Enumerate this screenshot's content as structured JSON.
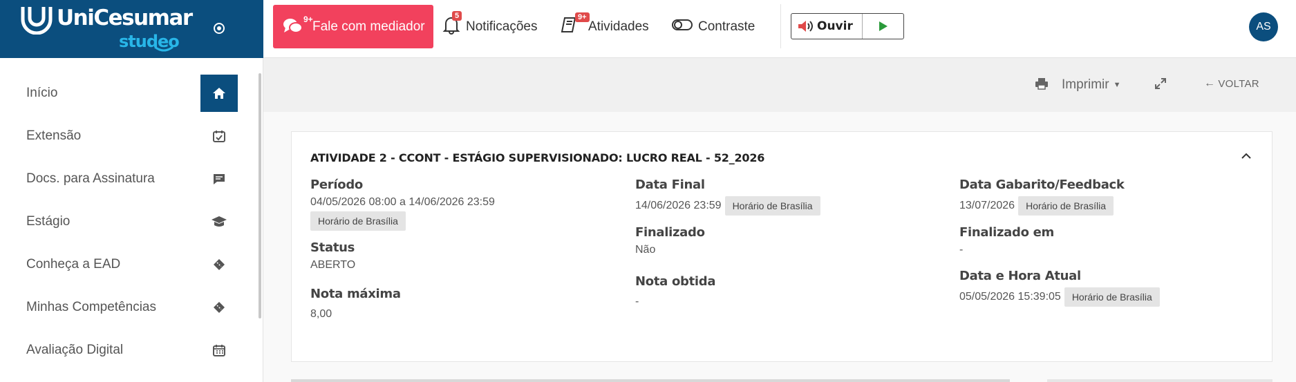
{
  "brand": {
    "name": "UniCesumar",
    "sub": "studeo",
    "primary": "#0b4e7e",
    "accent": "#28b6e8"
  },
  "header": {
    "mediador": {
      "label": "Fale com mediador",
      "badge": "9+",
      "color": "#f2415d"
    },
    "notificacoes": {
      "label": "Notificações",
      "badge": "5"
    },
    "atividades": {
      "label": "Atividades",
      "badge": "9+"
    },
    "contraste": {
      "label": "Contraste"
    },
    "ouvir": {
      "label": "Ouvir"
    },
    "avatar": "AS"
  },
  "sidebar": {
    "items": [
      {
        "label": "Início",
        "icon": "home-icon",
        "active": true
      },
      {
        "label": "Extensão",
        "icon": "calendar-check-icon"
      },
      {
        "label": "Docs. para Assinatura",
        "icon": "chat-icon"
      },
      {
        "label": "Estágio",
        "icon": "graduation-cap-icon"
      },
      {
        "label": "Conheça a EAD",
        "icon": "ticket-icon"
      },
      {
        "label": "Minhas Competências",
        "icon": "ticket-icon"
      },
      {
        "label": "Avaliação Digital",
        "icon": "calendar-icon"
      }
    ]
  },
  "toolbar": {
    "print_label": "Imprimir",
    "back_label": "VOLTAR"
  },
  "activity": {
    "title": "ATIVIDADE 2 - CCONT - ESTÁGIO SUPERVISIONADO: LUCRO REAL - 52_2026",
    "periodo_label": "Período",
    "periodo_value": "04/05/2026 08:00 a 14/06/2026 23:59",
    "tz": "Horário de Brasília",
    "status_label": "Status",
    "status_value": "ABERTO",
    "nota_max_label": "Nota máxima",
    "nota_max_value": "8,00",
    "data_final_label": "Data Final",
    "data_final_value": "14/06/2026 23:59",
    "finalizado_label": "Finalizado",
    "finalizado_value": "Não",
    "nota_obtida_label": "Nota obtida",
    "nota_obtida_value": "-",
    "gabarito_label": "Data Gabarito/Feedback",
    "gabarito_value": "13/07/2026",
    "finalizado_em_label": "Finalizado em",
    "finalizado_em_value": "-",
    "data_atual_label": "Data e Hora Atual",
    "data_atual_value": "05/05/2026 15:39:05"
  }
}
